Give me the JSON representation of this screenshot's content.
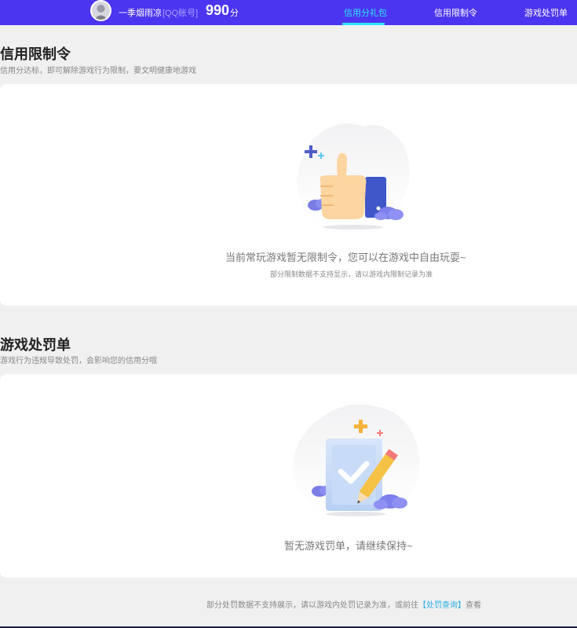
{
  "header": {
    "user_name": "一季烟雨凉",
    "account_type": "[QQ账号]",
    "score_value": "990",
    "score_unit": "分",
    "tabs": [
      {
        "label": "信用分礼包",
        "active": true
      },
      {
        "label": "信用限制令",
        "active": false
      },
      {
        "label": "游戏处罚单",
        "active": false
      }
    ]
  },
  "restriction_section": {
    "title": "信用限制令",
    "subtitle": "信用分达标，即可解除游戏行为限制，要文明健康地游戏",
    "empty_message": "当前常玩游戏暂无限制令，您可以在游戏中自由玩耍~",
    "empty_note": "部分限制数据不支持显示，请以游戏内限制记录为准"
  },
  "penalty_section": {
    "title": "游戏处罚单",
    "subtitle": "游戏行为违规导致处罚，会影响您的信用分哦",
    "empty_message": "暂无游戏罚单，请继续保持~"
  },
  "footer": {
    "note_prefix": "部分处罚数据不支持展示，请以游戏内处罚记录为准，或前往",
    "link_label": "【处罚查询】",
    "note_suffix": "查看"
  },
  "colors": {
    "topbar": "#4c35f0",
    "active_tab": "#2ee6ff",
    "link": "#29aee6"
  },
  "icons": {
    "avatar": "user-avatar",
    "thumbs_up": "thumbs-up-illustration",
    "clipboard_check": "clipboard-check-illustration"
  }
}
